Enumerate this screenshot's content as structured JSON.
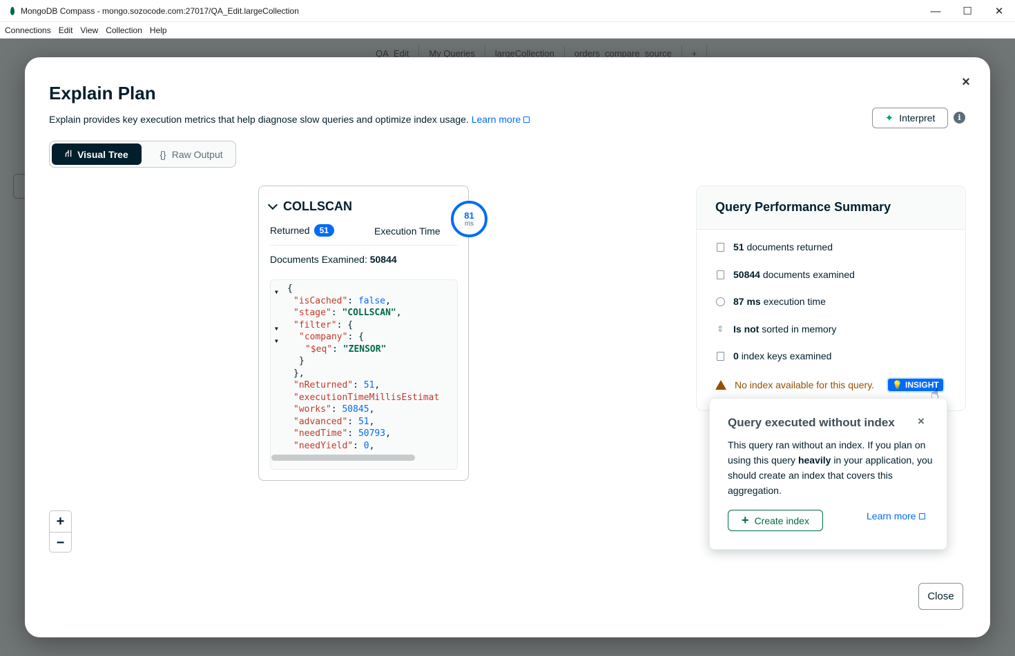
{
  "window": {
    "title": "MongoDB Compass - mongo.sozocode.com:27017/QA_Edit.largeCollection",
    "minimize": "—",
    "maximize": "☐",
    "close": "✕"
  },
  "menu": [
    "Connections",
    "Edit",
    "View",
    "Collection",
    "Help"
  ],
  "background": {
    "tabs": [
      "QA_Edit",
      "My Queries",
      "largeCollection",
      "orders_compare_source"
    ],
    "add_tab": "+"
  },
  "modal": {
    "title": "Explain Plan",
    "description": "Explain provides key execution metrics that help diagnose slow queries and optimize index usage.",
    "learn_more": "Learn more",
    "interpret_label": "Interpret",
    "info": "i",
    "close_x": "×",
    "view_toggle": {
      "visual_tree": "Visual Tree",
      "raw_output": "Raw Output",
      "selected": "Visual Tree"
    },
    "close_button": "Close"
  },
  "stage": {
    "name": "COLLSCAN",
    "returned_label": "Returned",
    "returned_count": "51",
    "execution_time_label": "Execution Time",
    "execution_time_value": "81",
    "execution_time_unit": "ms",
    "docs_examined_label": "Documents Examined:",
    "docs_examined_value": "50844"
  },
  "zoom": {
    "in": "+",
    "out": "−"
  },
  "summary": {
    "title": "Query Performance Summary",
    "returned_value": "51",
    "returned_text": "documents returned",
    "examined_value": "50844",
    "examined_text": "documents examined",
    "exec_value": "87 ms",
    "exec_text": "execution time",
    "sorted_value": "Is not",
    "sorted_text": "sorted in memory",
    "keys_value": "0",
    "keys_text": "index keys examined",
    "warning": "No index available for this query.",
    "insight_badge": "INSIGHT"
  },
  "popover": {
    "title": "Query executed without index",
    "close": "×",
    "body_1": "This query ran without an index. If you plan on using this query",
    "body_bold": "heavily",
    "body_2": "in your application, you should create an index that covers this aggregation.",
    "create_index": "Create index",
    "learn_more": "Learn more"
  },
  "colors": {
    "accent_blue": "#016bf8",
    "brand_green": "#00684a",
    "dark": "#001e2b",
    "warning": "#944f01"
  }
}
